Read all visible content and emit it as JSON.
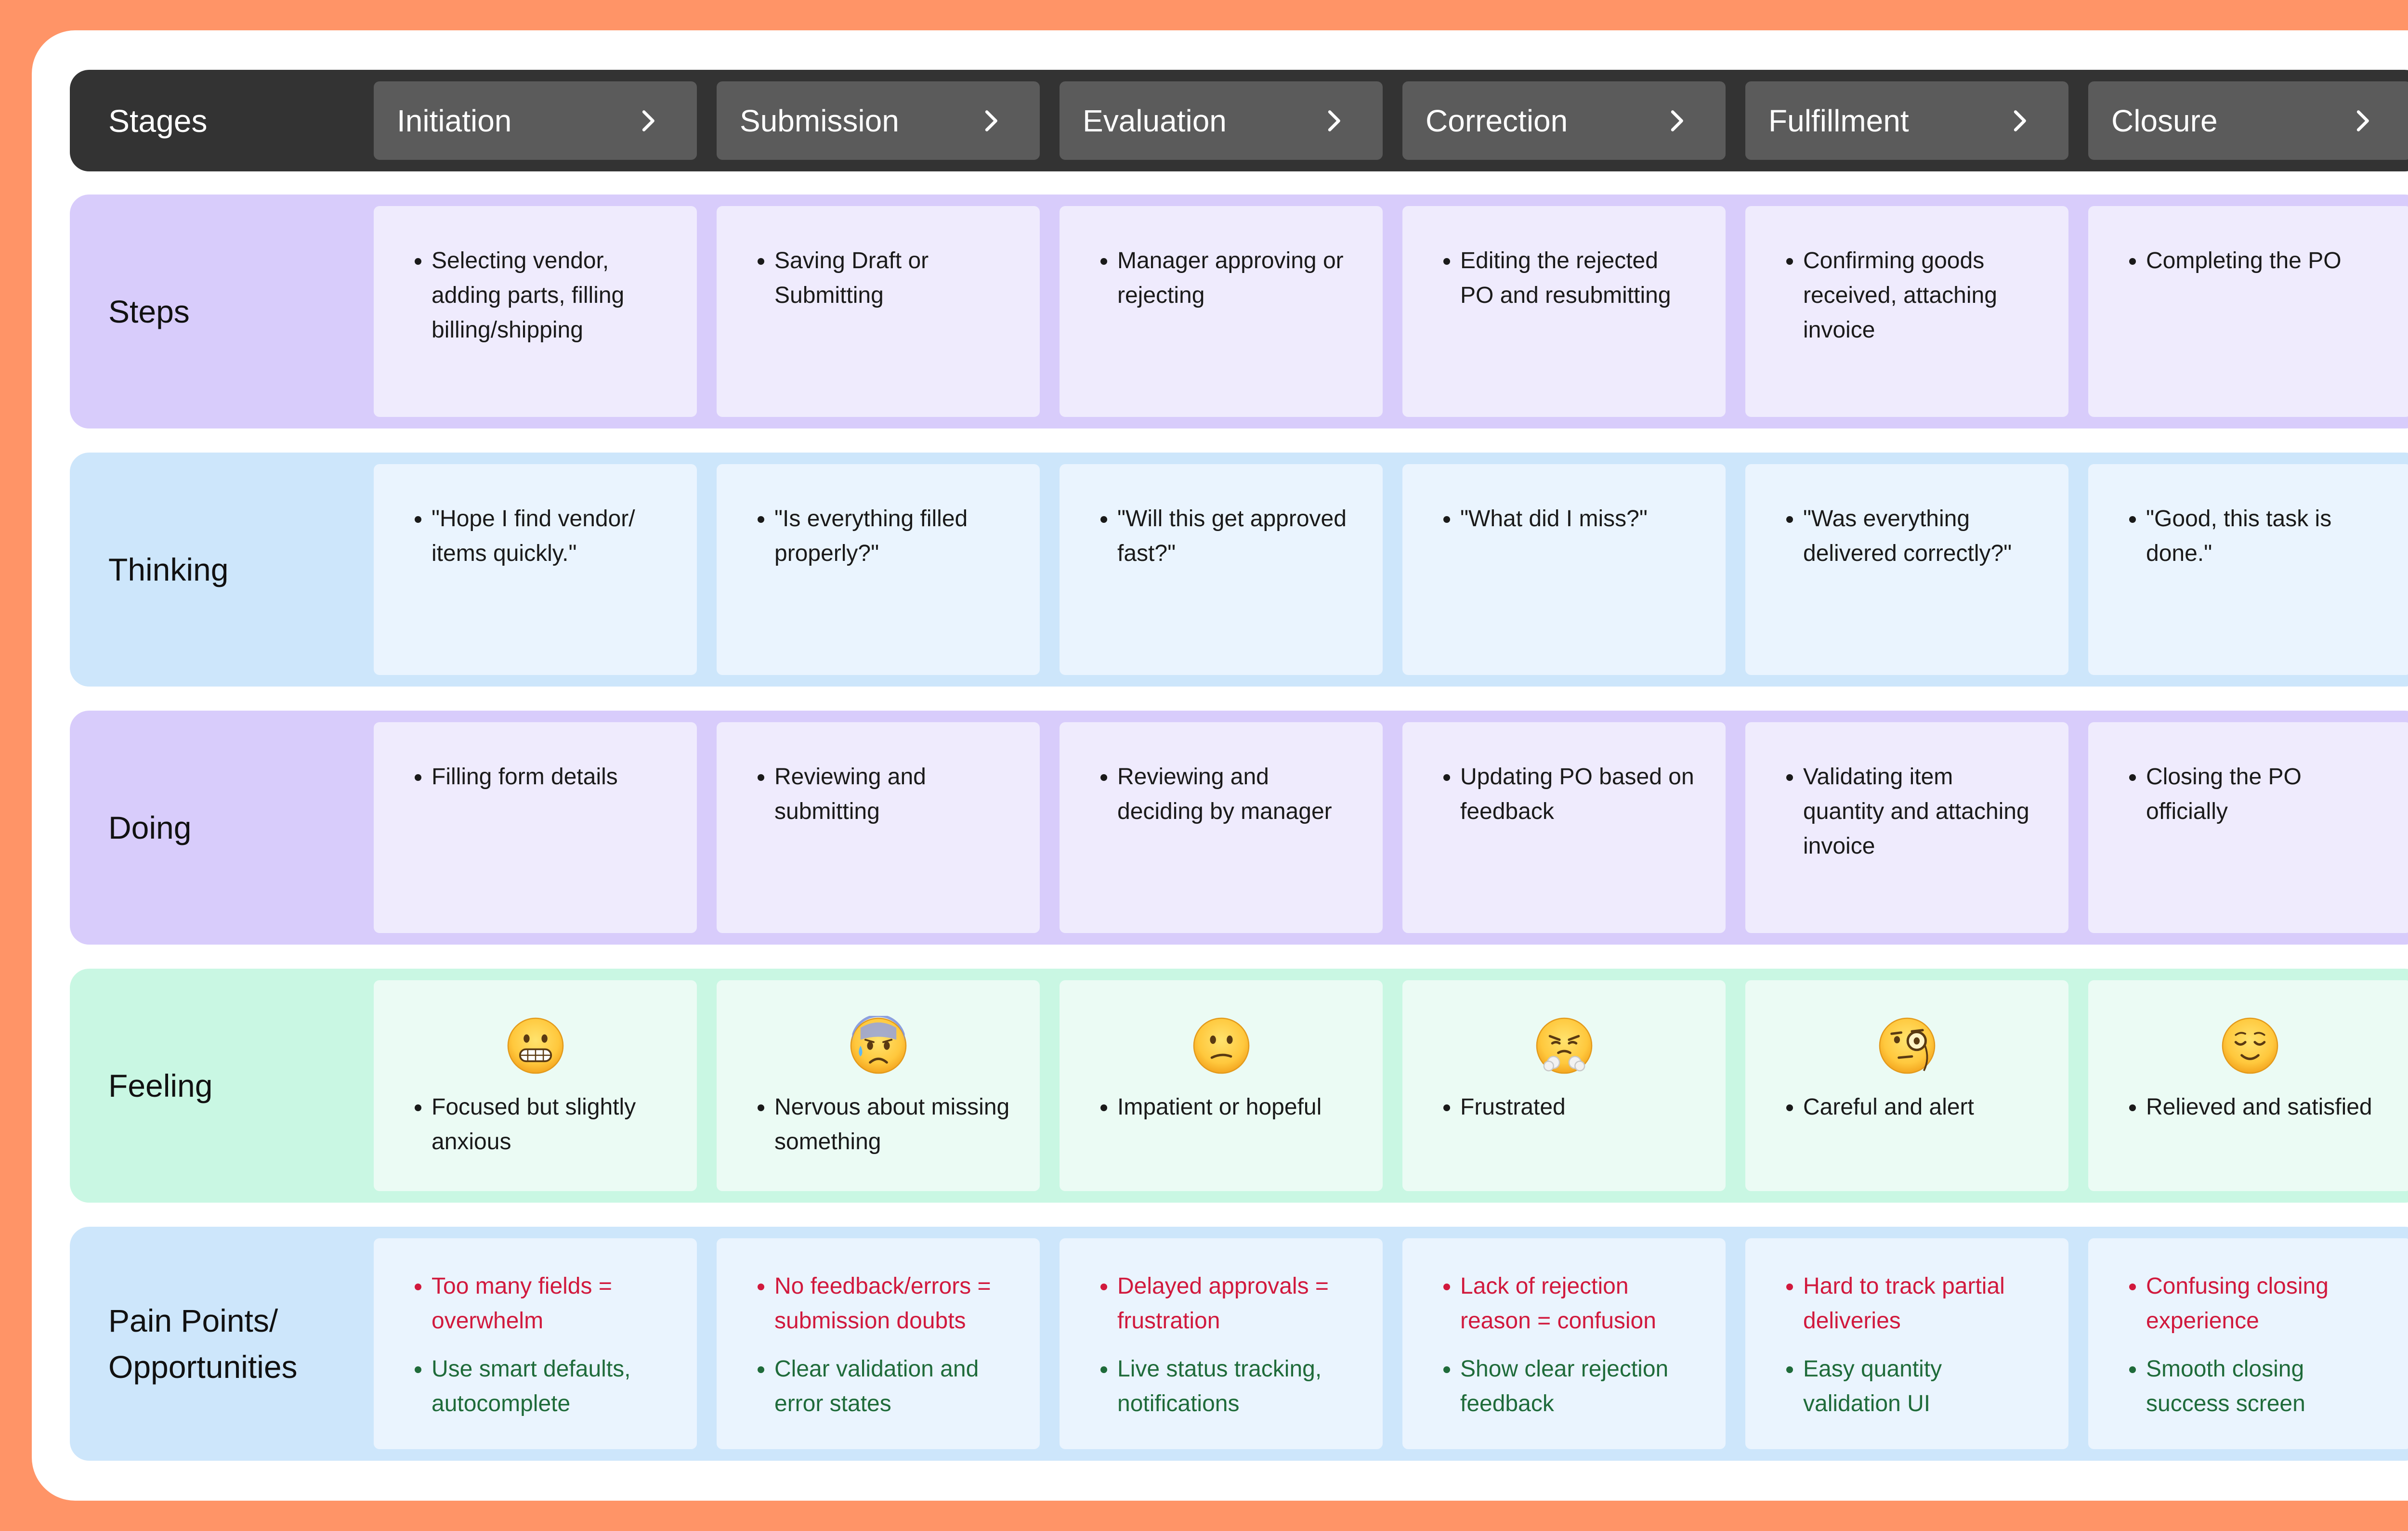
{
  "header": {
    "label": "Stages",
    "stages": [
      "Initiation",
      "Submission",
      "Evaluation",
      "Correction",
      "Fulfillment",
      "Closure"
    ]
  },
  "rows": {
    "steps": {
      "label": "Steps",
      "cells": [
        "Selecting vendor, adding parts, filling billing/shipping",
        "Saving Draft or Submitting",
        "Manager approving or rejecting",
        "Editing the rejected PO and resubmitting",
        "Confirming goods received, attaching invoice",
        "Completing the PO"
      ]
    },
    "thinking": {
      "label": "Thinking",
      "cells": [
        "\"Hope I find vendor/ items quickly.\"",
        "\"Is everything filled properly?\"",
        "\"Will this get approved fast?\"",
        "\"What did I miss?\"",
        "\"Was everything delivered correctly?\"",
        "\"Good, this task is done.\""
      ]
    },
    "doing": {
      "label": "Doing",
      "cells": [
        "Filling form details",
        "Reviewing and submitting",
        "Reviewing and deciding by manager",
        "Updating PO based on feedback",
        "Validating item quantity and attaching invoice",
        "Closing the PO officially"
      ]
    },
    "feeling": {
      "label": "Feeling",
      "cells": [
        {
          "emoji": "grimacing-face-icon",
          "text": "Focused but slightly anxious"
        },
        {
          "emoji": "anxious-face-with-sweat-icon",
          "text": "Nervous about missing something"
        },
        {
          "emoji": "confused-face-icon",
          "text": "Impatient or hopeful"
        },
        {
          "emoji": "face-with-steam-from-nose-icon",
          "text": "Frustrated"
        },
        {
          "emoji": "face-with-monocle-icon",
          "text": "Careful and alert"
        },
        {
          "emoji": "relieved-face-icon",
          "text": "Relieved and satisfied"
        }
      ]
    },
    "pain": {
      "label_line1": "Pain Points/",
      "label_line2": "Opportunities",
      "cells": [
        {
          "pain": "Too many fields = overwhelm",
          "opp": "Use smart defaults, autocomplete"
        },
        {
          "pain": "No feedback/errors = submission doubts",
          "opp": "Clear validation and error states"
        },
        {
          "pain": "Delayed approvals = frustration",
          "opp": "Live status tracking, notifications"
        },
        {
          "pain": "Lack of rejection reason = confusion",
          "opp": "Show clear rejection feedback"
        },
        {
          "pain": "Hard to track partial deliveries",
          "opp": "Easy quantity validation UI"
        },
        {
          "pain": "Confusing closing experience",
          "opp": "Smooth closing success screen"
        }
      ]
    }
  },
  "colors": {
    "frame_border": "#FF9467",
    "header_bg": "#333333",
    "stage_bg": "#5B5B5B",
    "purple_row": "#D8CCFB",
    "purple_cell": "#EFEBFD",
    "blue_row": "#CDE6FB",
    "blue_cell": "#EAF4FE",
    "green_row": "#C9F7E3",
    "green_cell": "#EBFBF4",
    "pain_text": "#D1193D",
    "opportunity_text": "#1F6B3A"
  }
}
